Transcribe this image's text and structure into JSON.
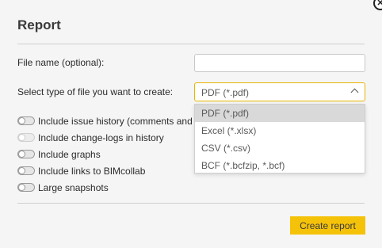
{
  "dialog": {
    "title": "Report",
    "close_glyph": "✕"
  },
  "form": {
    "filename_label": "File name (optional):",
    "filename_value": "",
    "filetype_label": "Select type of file you want to create:",
    "filetype_selected": "PDF (*.pdf)",
    "filetype_options": [
      "PDF (*.pdf)",
      "Excel (*.xlsx)",
      "CSV (*.csv)",
      "BCF (*.bcfzip, *.bcf)"
    ]
  },
  "toggles": [
    {
      "label": "Include issue history (comments and",
      "on": false,
      "disabled": false
    },
    {
      "label": "Include change-logs in history",
      "on": false,
      "disabled": true
    },
    {
      "label": "Include graphs",
      "on": false,
      "disabled": false
    },
    {
      "label": "Include links to BIMcollab",
      "on": false,
      "disabled": false
    },
    {
      "label": "Large snapshots",
      "on": false,
      "disabled": false
    }
  ],
  "footer": {
    "create_label": "Create report"
  },
  "colors": {
    "accent": "#f5c20a",
    "focus_border": "#e8b400"
  }
}
